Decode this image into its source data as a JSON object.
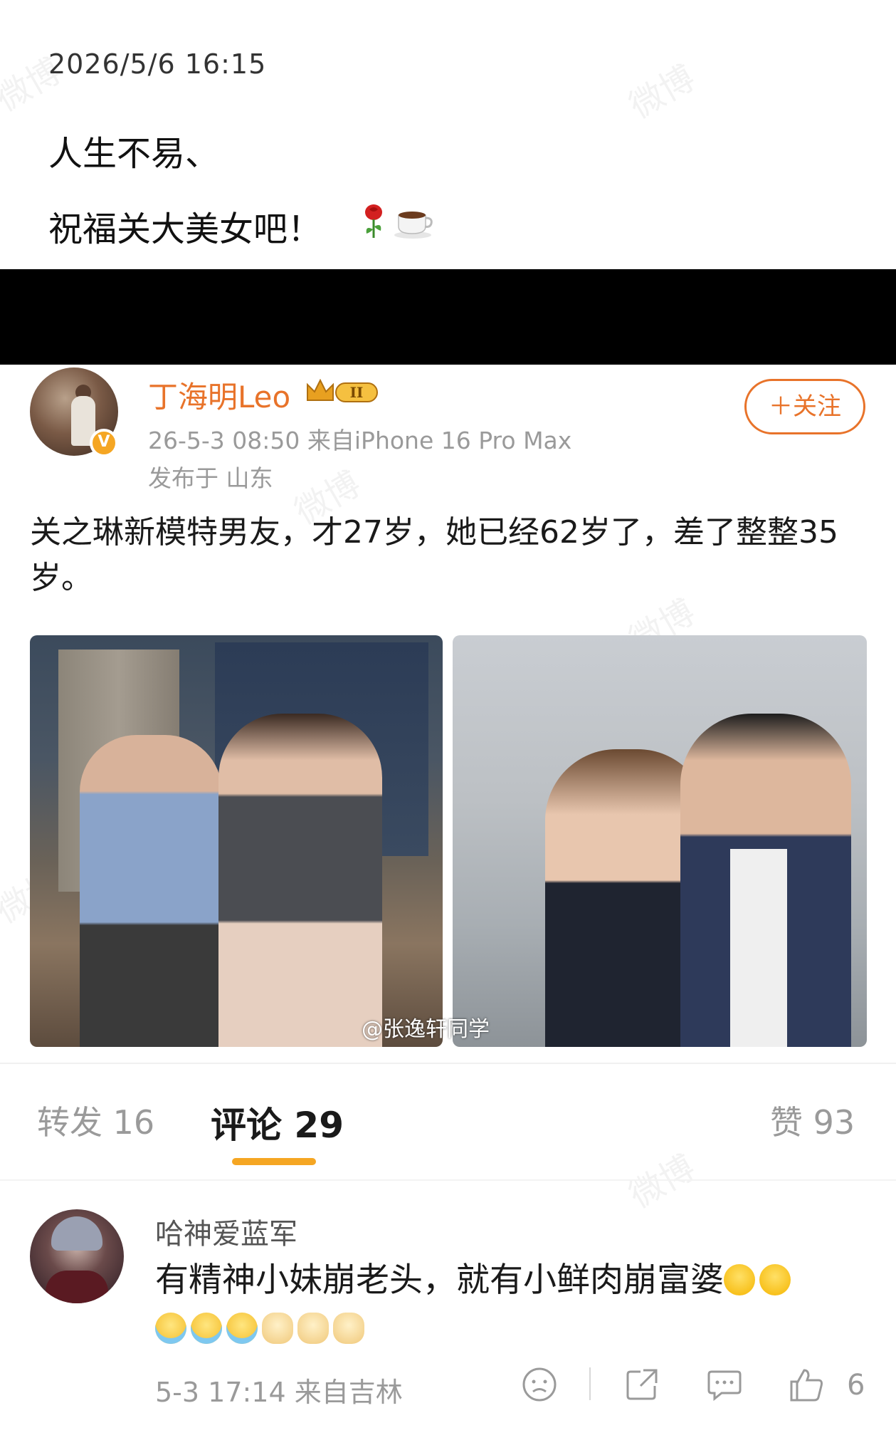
{
  "caption": {
    "datetime": "2026/5/6 16:15",
    "line1": "人生不易、",
    "line2": "祝福关大美女吧！",
    "emoji_icons": [
      "rose-icon",
      "coffee-icon"
    ]
  },
  "post": {
    "author": "丁海明Leo",
    "verified_badge": "V",
    "rank_badge": "II",
    "meta": "26-5-3 08:50  来自iPhone 16 Pro Max",
    "location": "发布于 山东",
    "follow_label": "＋关注",
    "text": "关之琳新模特男友，才27岁，她已经62岁了，差了整整35岁。",
    "image_watermark": "@张逸轩同学",
    "accent_color": "#e8732a"
  },
  "tabs": {
    "repost": "转发 16",
    "comment": "评论 29",
    "like": "赞 93",
    "active_underline_color": "#f5a623"
  },
  "comment": {
    "user": "哈神爱蓝军",
    "text": "有精神小妹崩老头，就有小鲜肉崩富婆",
    "time": "5-3 17:14  来自吉林",
    "like_count": "6"
  },
  "watermark_text": "微博"
}
